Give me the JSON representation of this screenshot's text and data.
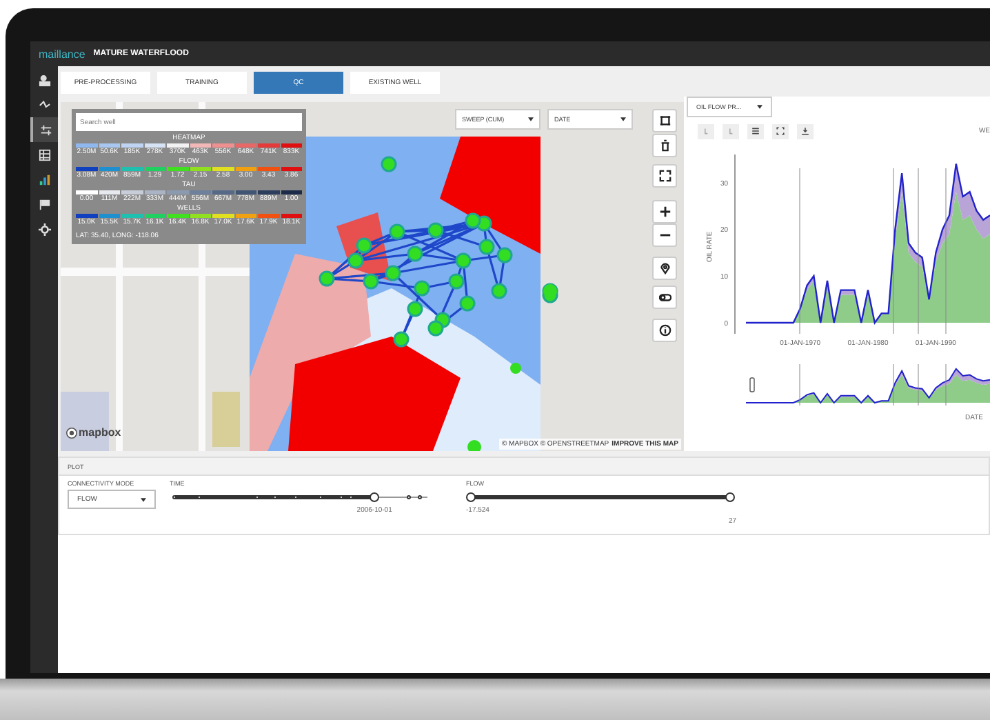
{
  "app": {
    "logo": "maillance",
    "title": "MATURE WATERFLOOD"
  },
  "sidebar": {
    "items": [
      {
        "kind": "person",
        "selected": false
      },
      {
        "kind": "network",
        "selected": false
      },
      {
        "kind": "sliders",
        "selected": true
      },
      {
        "kind": "table",
        "selected": false
      },
      {
        "kind": "chart",
        "selected": false
      },
      {
        "kind": "flag",
        "selected": false
      },
      {
        "kind": "gear",
        "selected": false
      }
    ]
  },
  "tabs": [
    {
      "label": "PRE-PROCESSING",
      "selected": false
    },
    {
      "label": "TRAINING",
      "selected": false
    },
    {
      "label": "QC",
      "selected": true
    },
    {
      "label": "EXISTING WELL",
      "selected": false
    }
  ],
  "map": {
    "search": {
      "placeholder": "Search well"
    },
    "legend": [
      {
        "title": "HEATMAP",
        "swatches": [
          {
            "color": "#8fb8ee",
            "label": "2.50M"
          },
          {
            "color": "#a7c6f0",
            "label": "50.6K"
          },
          {
            "color": "#bed4f2",
            "label": "185K"
          },
          {
            "color": "#d6e3f5",
            "label": "278K"
          },
          {
            "color": "#f2f2f2",
            "label": "370K"
          },
          {
            "color": "#f2b8b8",
            "label": "463K"
          },
          {
            "color": "#ee9090",
            "label": "556K"
          },
          {
            "color": "#e86868",
            "label": "648K"
          },
          {
            "color": "#e43a3a",
            "label": "741K"
          },
          {
            "color": "#e01010",
            "label": "833K"
          }
        ]
      },
      {
        "title": "FLOW",
        "swatches": [
          {
            "color": "#1040c0",
            "label": "3.08M"
          },
          {
            "color": "#1e90d0",
            "label": "420M"
          },
          {
            "color": "#20c0b0",
            "label": "859M"
          },
          {
            "color": "#20d060",
            "label": "1.29"
          },
          {
            "color": "#40e020",
            "label": "1.72"
          },
          {
            "color": "#90e020",
            "label": "2.15"
          },
          {
            "color": "#e0e020",
            "label": "2.58"
          },
          {
            "color": "#f0a010",
            "label": "3.00"
          },
          {
            "color": "#f05010",
            "label": "3.43"
          },
          {
            "color": "#e01010",
            "label": "3.86"
          }
        ]
      },
      {
        "title": "TAU",
        "swatches": [
          {
            "color": "#ffffff",
            "label": "0.00"
          },
          {
            "color": "#e6e9ee",
            "label": "111M"
          },
          {
            "color": "#c8ced8",
            "label": "222M"
          },
          {
            "color": "#aab4c4",
            "label": "333M"
          },
          {
            "color": "#8c9ab0",
            "label": "444M"
          },
          {
            "color": "#6e809c",
            "label": "556M"
          },
          {
            "color": "#566a88",
            "label": "667M"
          },
          {
            "color": "#405474",
            "label": "778M"
          },
          {
            "color": "#2c3e5e",
            "label": "889M"
          },
          {
            "color": "#1c2c48",
            "label": "1.00"
          }
        ]
      },
      {
        "title": "WELLS",
        "swatches": [
          {
            "color": "#1040c0",
            "label": "15.0K"
          },
          {
            "color": "#1e90d0",
            "label": "15.5K"
          },
          {
            "color": "#20c0b0",
            "label": "15.7K"
          },
          {
            "color": "#20d060",
            "label": "16.1K"
          },
          {
            "color": "#40e020",
            "label": "16.4K"
          },
          {
            "color": "#90e020",
            "label": "16.8K"
          },
          {
            "color": "#e0e020",
            "label": "17.0K"
          },
          {
            "color": "#f0a010",
            "label": "17.6K"
          },
          {
            "color": "#f05010",
            "label": "17.9K"
          },
          {
            "color": "#e01010",
            "label": "18.1K"
          }
        ]
      }
    ],
    "coordinates": "LAT: 35.40, LONG: -118.06",
    "dropdowns": [
      {
        "value": "SWEEP (CUM)"
      },
      {
        "value": "DATE"
      }
    ],
    "controls": [
      {
        "kind": "select-box"
      },
      {
        "kind": "trash"
      },
      {
        "kind": "fullscreen"
      },
      {
        "kind": "zoom-in"
      },
      {
        "kind": "zoom-out"
      },
      {
        "kind": "pin"
      },
      {
        "kind": "toggle"
      },
      {
        "kind": "info"
      }
    ],
    "logo_text": "mapbox",
    "attribution": "© MAPBOX © OPENSTREETMAP",
    "improve_link": "IMPROVE THIS MAP"
  },
  "chart_panel": {
    "dropdown": "OIL FLOW PR...",
    "tools": [
      {
        "kind": "faint"
      },
      {
        "kind": "faint"
      },
      {
        "kind": "menu"
      },
      {
        "kind": "expand"
      },
      {
        "kind": "download"
      }
    ],
    "cut_label": "WE",
    "overview_label": "DATE",
    "chart_data": {
      "type": "area",
      "ylabel": "OIL RATE",
      "stacked": true,
      "ylim": [
        0,
        36
      ],
      "categories": [
        null,
        null,
        null,
        null,
        null,
        null,
        null,
        null,
        "01-JAN-1970",
        null,
        null,
        null,
        null,
        null,
        null,
        null,
        null,
        null,
        "01-JAN-1980",
        null,
        null,
        null,
        null,
        null,
        null,
        null,
        null,
        null,
        "01-JAN-1990",
        null,
        null,
        null,
        null,
        null,
        null,
        null,
        null
      ],
      "series": [
        {
          "color": "#8fcc8a",
          "values": [
            0,
            0,
            0,
            0,
            0,
            0,
            0,
            0,
            3,
            7,
            9,
            0,
            8,
            0,
            6,
            6,
            6,
            0,
            6,
            0,
            2,
            2,
            18,
            28,
            15,
            13,
            12,
            5,
            13,
            17,
            19,
            28,
            22,
            23,
            20,
            18,
            19
          ]
        },
        {
          "color": "#b8a4d6",
          "values": [
            0,
            0,
            0,
            0,
            0,
            0,
            0,
            0,
            0,
            1,
            1,
            0,
            1,
            0,
            1,
            1,
            1,
            0,
            1,
            0,
            0,
            0,
            2,
            4,
            2,
            2,
            2,
            0,
            2,
            3,
            4,
            6,
            5,
            5,
            4,
            4,
            4
          ]
        }
      ],
      "yticks": [
        0,
        10,
        20,
        30
      ]
    }
  },
  "plot": {
    "title": "PLOT",
    "connectivity": {
      "label": "CONNECTIVITY MODE",
      "value": "FLOW"
    },
    "time": {
      "label": "TIME",
      "level": 0.79,
      "value_label": "2006-10-01"
    },
    "flow": {
      "label": "FLOW",
      "level": 1,
      "min_label": "-17.524",
      "max_label": "27"
    }
  }
}
